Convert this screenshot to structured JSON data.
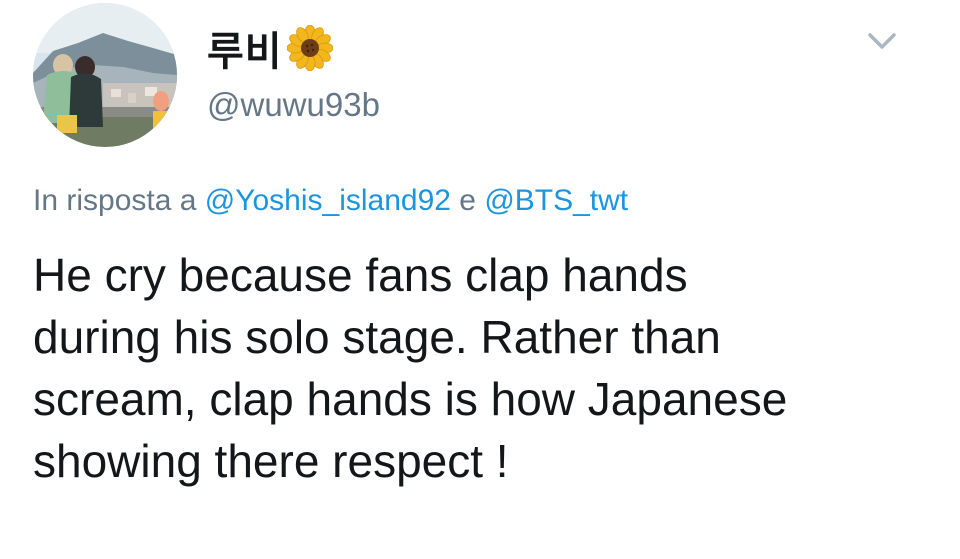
{
  "tweet": {
    "display_name": "루비",
    "name_emoji": "sunflower-emoji",
    "handle": "@wuwu93b",
    "reply_prefix": "In risposta a",
    "reply_mention_1": "@Yoshis_island92",
    "reply_joiner": "e",
    "reply_mention_2": "@BTS_twt",
    "text": "He cry because fans clap hands\nduring his solo stage. Rather than\nscream, clap hands is how Japanese\nshowing there respect !",
    "menu_icon": "chevron-down-icon"
  },
  "colors": {
    "text_primary": "#14171a",
    "text_secondary": "#657786",
    "link": "#1b95e0",
    "chevron": "#aab8c2"
  }
}
